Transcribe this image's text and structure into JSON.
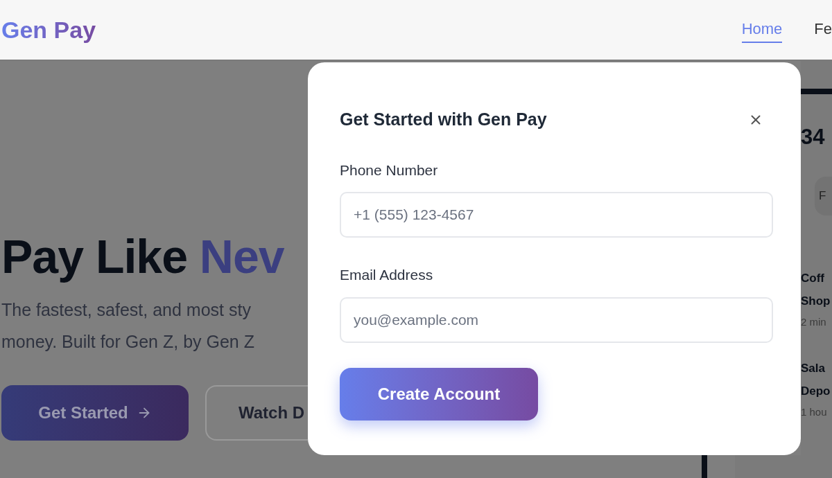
{
  "header": {
    "logo": "Gen Pay",
    "nav": [
      {
        "label": "Home",
        "selected": true
      },
      {
        "label": "Fe",
        "selected": false
      }
    ]
  },
  "hero": {
    "title": "Pay Like",
    "title_accent": "Nev",
    "subtitle_lines": [
      "The fastest, safest, and most sty",
      "money. Built for Gen Z, by Gen Z"
    ],
    "buttons": [
      {
        "label": "Get Started",
        "kind": "primary"
      },
      {
        "label": "Watch D",
        "kind": "secondary"
      }
    ]
  },
  "preview": {
    "balance": "34",
    "pill": "F",
    "transactions": [
      {
        "name_lines": [
          "Coff",
          "Shop"
        ],
        "time": "2 min"
      },
      {
        "name_lines": [
          "Sala",
          "Depo"
        ],
        "time": "1 hou"
      }
    ]
  },
  "modal": {
    "title": "Get Started with Gen Pay",
    "fields": [
      {
        "label": "Phone Number",
        "placeholder": "+1 (555) 123-4567"
      },
      {
        "label": "Email Address",
        "placeholder": "you@example.com"
      }
    ],
    "submit": "Create Account"
  }
}
